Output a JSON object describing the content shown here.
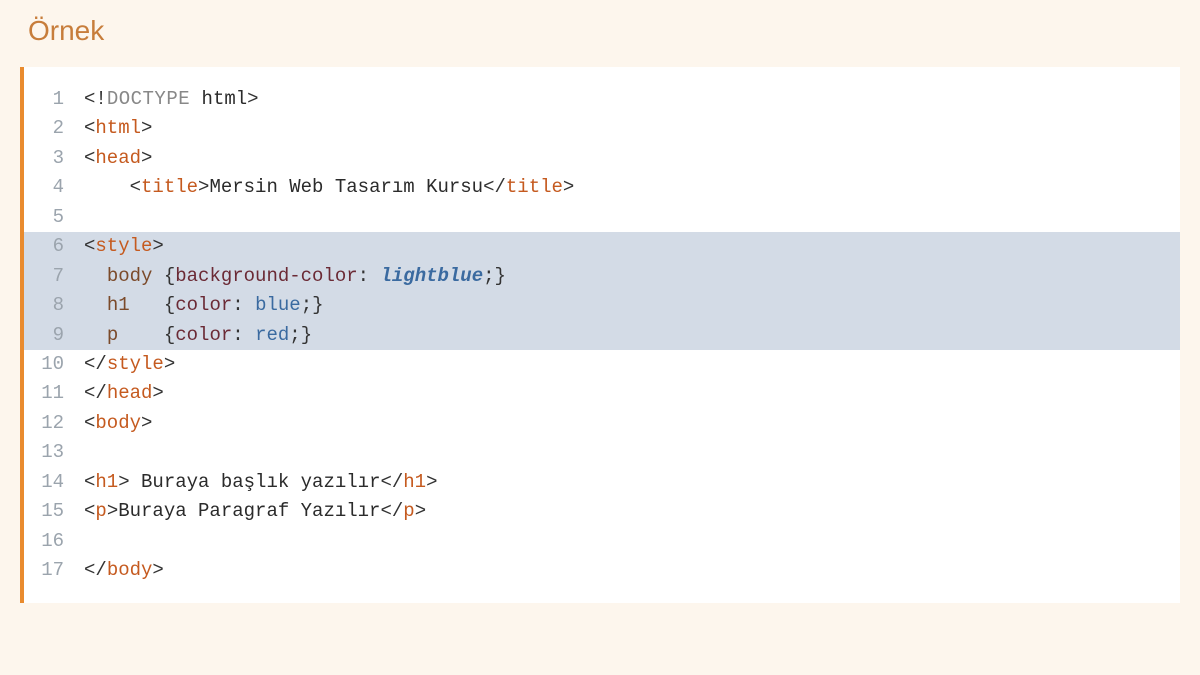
{
  "heading": "Örnek",
  "code": {
    "lines": [
      {
        "num": "1",
        "highlighted": false,
        "tokens": [
          {
            "t": "punct",
            "v": "<!"
          },
          {
            "t": "doctype",
            "v": "DOCTYPE"
          },
          {
            "t": "attr-text",
            "v": " html"
          },
          {
            "t": "punct",
            "v": ">"
          }
        ]
      },
      {
        "num": "2",
        "highlighted": false,
        "tokens": [
          {
            "t": "punct",
            "v": "<"
          },
          {
            "t": "tag",
            "v": "html"
          },
          {
            "t": "punct",
            "v": ">"
          }
        ]
      },
      {
        "num": "3",
        "highlighted": false,
        "tokens": [
          {
            "t": "punct",
            "v": "<"
          },
          {
            "t": "tag",
            "v": "head"
          },
          {
            "t": "punct",
            "v": ">"
          }
        ]
      },
      {
        "num": "4",
        "highlighted": false,
        "tokens": [
          {
            "t": "attr-text",
            "v": "    "
          },
          {
            "t": "punct",
            "v": "<"
          },
          {
            "t": "tag",
            "v": "title"
          },
          {
            "t": "punct",
            "v": ">"
          },
          {
            "t": "attr-text",
            "v": "Mersin Web Tasarım Kursu"
          },
          {
            "t": "punct",
            "v": "</"
          },
          {
            "t": "tag",
            "v": "title"
          },
          {
            "t": "punct",
            "v": ">"
          }
        ]
      },
      {
        "num": "5",
        "highlighted": false,
        "tokens": [
          {
            "t": "attr-text",
            "v": " "
          }
        ]
      },
      {
        "num": "6",
        "highlighted": true,
        "tokens": [
          {
            "t": "punct",
            "v": "<"
          },
          {
            "t": "tag",
            "v": "style"
          },
          {
            "t": "punct",
            "v": ">"
          }
        ]
      },
      {
        "num": "7",
        "highlighted": true,
        "tokens": [
          {
            "t": "attr-text",
            "v": "  "
          },
          {
            "t": "css-selector",
            "v": "body"
          },
          {
            "t": "attr-text",
            "v": " "
          },
          {
            "t": "brace",
            "v": "{"
          },
          {
            "t": "css-prop",
            "v": "background-color"
          },
          {
            "t": "punct",
            "v": ": "
          },
          {
            "t": "css-value-italic",
            "v": "lightblue"
          },
          {
            "t": "punct",
            "v": ";"
          },
          {
            "t": "brace",
            "v": "}"
          }
        ]
      },
      {
        "num": "8",
        "highlighted": true,
        "tokens": [
          {
            "t": "attr-text",
            "v": "  "
          },
          {
            "t": "css-selector",
            "v": "h1"
          },
          {
            "t": "attr-text",
            "v": "   "
          },
          {
            "t": "brace",
            "v": "{"
          },
          {
            "t": "css-prop",
            "v": "color"
          },
          {
            "t": "punct",
            "v": ": "
          },
          {
            "t": "css-value",
            "v": "blue"
          },
          {
            "t": "punct",
            "v": ";"
          },
          {
            "t": "brace",
            "v": "}"
          }
        ]
      },
      {
        "num": "9",
        "highlighted": true,
        "tokens": [
          {
            "t": "attr-text",
            "v": "  "
          },
          {
            "t": "css-selector",
            "v": "p"
          },
          {
            "t": "attr-text",
            "v": "    "
          },
          {
            "t": "brace",
            "v": "{"
          },
          {
            "t": "css-prop",
            "v": "color"
          },
          {
            "t": "punct",
            "v": ": "
          },
          {
            "t": "css-value",
            "v": "red"
          },
          {
            "t": "punct",
            "v": ";"
          },
          {
            "t": "brace",
            "v": "}"
          }
        ]
      },
      {
        "num": "10",
        "highlighted": false,
        "tokens": [
          {
            "t": "punct",
            "v": "</"
          },
          {
            "t": "tag",
            "v": "style"
          },
          {
            "t": "punct",
            "v": ">"
          }
        ]
      },
      {
        "num": "11",
        "highlighted": false,
        "tokens": [
          {
            "t": "punct",
            "v": "</"
          },
          {
            "t": "tag",
            "v": "head"
          },
          {
            "t": "punct",
            "v": ">"
          }
        ]
      },
      {
        "num": "12",
        "highlighted": false,
        "tokens": [
          {
            "t": "punct",
            "v": "<"
          },
          {
            "t": "tag",
            "v": "body"
          },
          {
            "t": "punct",
            "v": ">"
          }
        ]
      },
      {
        "num": "13",
        "highlighted": false,
        "tokens": [
          {
            "t": "attr-text",
            "v": " "
          }
        ]
      },
      {
        "num": "14",
        "highlighted": false,
        "tokens": [
          {
            "t": "punct",
            "v": "<"
          },
          {
            "t": "tag",
            "v": "h1"
          },
          {
            "t": "punct",
            "v": ">"
          },
          {
            "t": "attr-text",
            "v": " Buraya başlık yazılır"
          },
          {
            "t": "punct",
            "v": "</"
          },
          {
            "t": "tag",
            "v": "h1"
          },
          {
            "t": "punct",
            "v": ">"
          }
        ]
      },
      {
        "num": "15",
        "highlighted": false,
        "tokens": [
          {
            "t": "punct",
            "v": "<"
          },
          {
            "t": "tag",
            "v": "p"
          },
          {
            "t": "punct",
            "v": ">"
          },
          {
            "t": "attr-text",
            "v": "Buraya Paragraf Yazılır"
          },
          {
            "t": "punct",
            "v": "</"
          },
          {
            "t": "tag",
            "v": "p"
          },
          {
            "t": "punct",
            "v": ">"
          }
        ]
      },
      {
        "num": "16",
        "highlighted": false,
        "tokens": [
          {
            "t": "attr-text",
            "v": " "
          }
        ]
      },
      {
        "num": "17",
        "highlighted": false,
        "tokens": [
          {
            "t": "punct",
            "v": "</"
          },
          {
            "t": "tag",
            "v": "body"
          },
          {
            "t": "punct",
            "v": ">"
          }
        ]
      }
    ]
  }
}
